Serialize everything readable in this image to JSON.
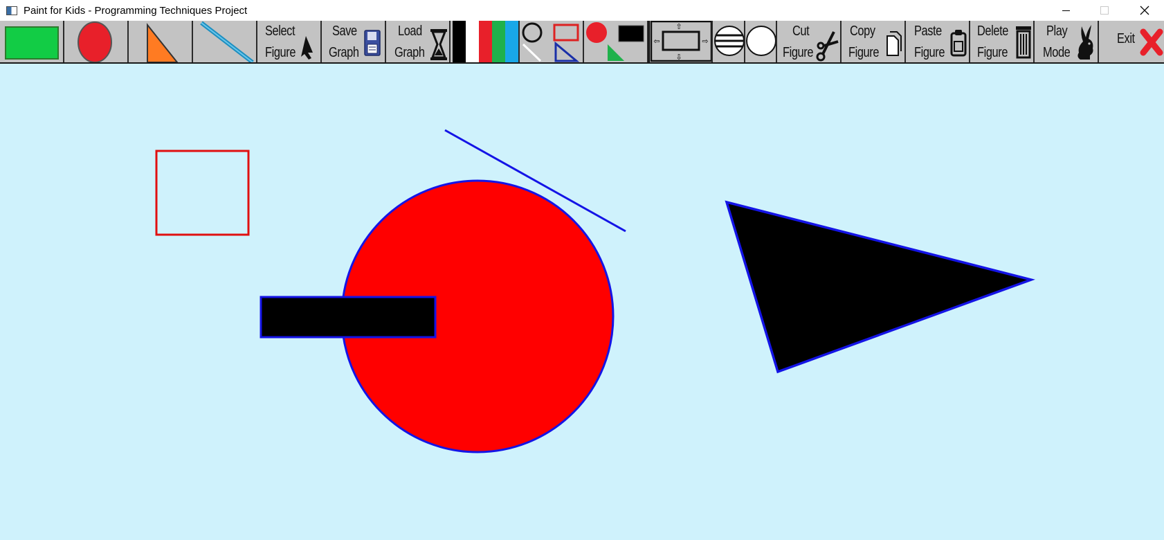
{
  "window": {
    "title": "Paint for Kids - Programming Techniques Project",
    "close_glyph": "✕"
  },
  "toolbar": {
    "tools": [
      {
        "name": "rectangle-tool",
        "icon": "green-rectangle-icon"
      },
      {
        "name": "circle-tool",
        "icon": "red-circle-icon"
      },
      {
        "name": "triangle-tool",
        "icon": "orange-triangle-icon"
      },
      {
        "name": "line-tool",
        "icon": "blue-line-icon"
      },
      {
        "name": "select-figure",
        "line1": "Select",
        "line2": "Figure",
        "icon": "cursor-icon"
      },
      {
        "name": "save-graph",
        "line1": "Save",
        "line2": "Graph",
        "icon": "floppy-disk-icon"
      },
      {
        "name": "load-graph",
        "line1": "Load",
        "line2": "Graph",
        "icon": "hourglass-icon"
      },
      {
        "name": "color-palette",
        "icon": "color-palette-icon"
      },
      {
        "name": "change-draw-color",
        "icon": "draw-color-icon"
      },
      {
        "name": "change-fill-color",
        "icon": "fill-color-icon"
      },
      {
        "name": "resize-figure",
        "icon": "resize-icon"
      },
      {
        "name": "change-border-width",
        "icon": "border-width-icon"
      },
      {
        "name": "cut-figure",
        "line1": "Cut",
        "line2": "Figure",
        "icon": "scissors-icon"
      },
      {
        "name": "copy-figure",
        "line1": "Copy",
        "line2": "Figure",
        "icon": "copy-icon"
      },
      {
        "name": "paste-figure",
        "line1": "Paste",
        "line2": "Figure",
        "icon": "clipboard-icon"
      },
      {
        "name": "delete-figure",
        "line1": "Delete",
        "line2": "Figure",
        "icon": "trash-icon"
      },
      {
        "name": "play-mode",
        "line1": "Play",
        "line2": "Mode",
        "icon": "bunny-icon"
      },
      {
        "name": "exit",
        "line1": "Exit",
        "icon": "red-x-icon"
      }
    ],
    "palette_colors": [
      "#000000",
      "#ffffff",
      "#e8202a",
      "#1fb14b",
      "#19a8e8"
    ]
  },
  "canvas": {
    "background": "#cff2fc",
    "figures": [
      {
        "type": "rectangle",
        "fill": "none",
        "border": "#e01010"
      },
      {
        "type": "line",
        "color": "#1414e6"
      },
      {
        "type": "circle",
        "fill": "#ff0000",
        "border": "#1414e6"
      },
      {
        "type": "rectangle",
        "fill": "#000000",
        "border": "#1414e6"
      },
      {
        "type": "triangle",
        "fill": "#000000",
        "border": "#1414e6"
      }
    ]
  }
}
